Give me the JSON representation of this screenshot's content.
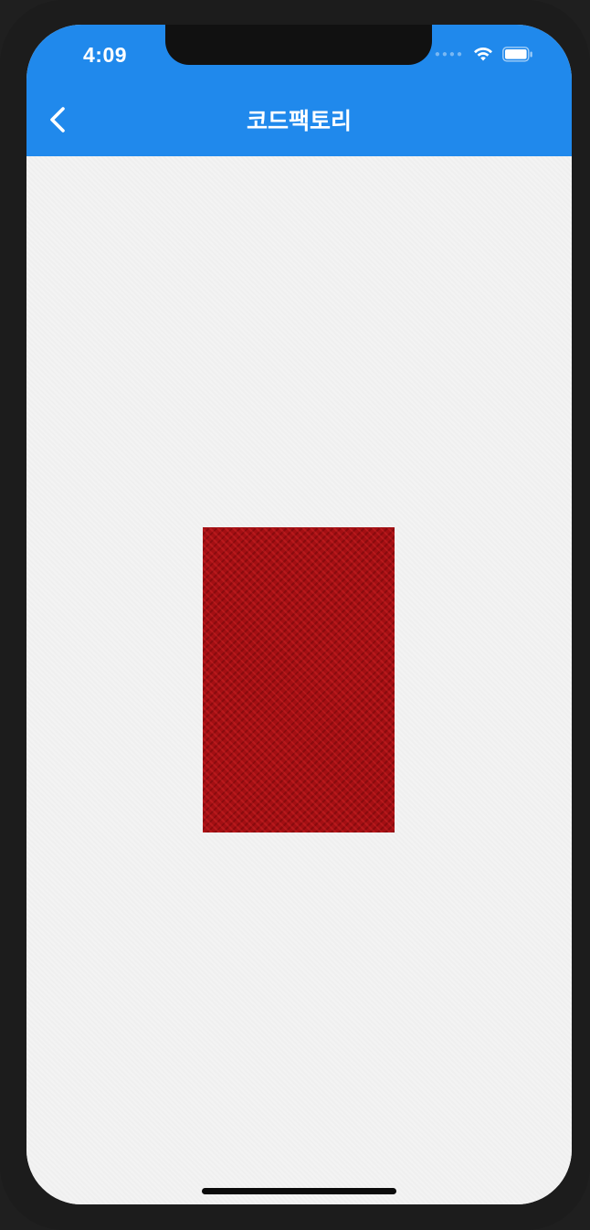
{
  "status_bar": {
    "time": "4:09",
    "signal_icon": "signal-dots-icon",
    "wifi_icon": "wifi-icon",
    "battery_icon": "battery-icon"
  },
  "app_bar": {
    "title": "코드팩토리",
    "back_icon": "chevron-left-icon",
    "color": "#2089ec"
  },
  "content": {
    "box_color": "#a40f13",
    "background_color": "#f3f3f3"
  }
}
